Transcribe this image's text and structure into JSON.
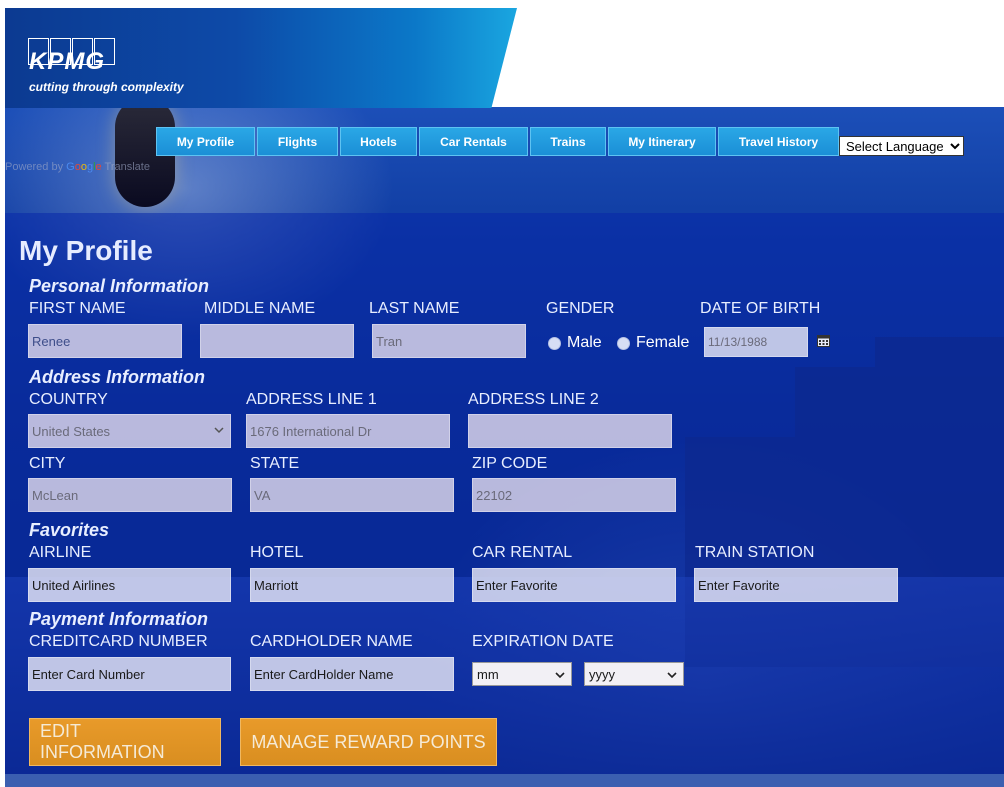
{
  "brand": {
    "logo_text": "KPMG",
    "tagline": "cutting through complexity"
  },
  "nav": {
    "items": [
      {
        "label": "My Profile"
      },
      {
        "label": "Flights"
      },
      {
        "label": "Hotels"
      },
      {
        "label": "Car Rentals"
      },
      {
        "label": "Trains"
      },
      {
        "label": "My Itinerary"
      },
      {
        "label": "Travel History"
      }
    ],
    "language_select": "Select Language"
  },
  "powered_by": {
    "prefix": "Powered by",
    "google": [
      "G",
      "o",
      "o",
      "g",
      "l",
      "e"
    ],
    "suffix": "Translate"
  },
  "page": {
    "title": "My Profile"
  },
  "personal": {
    "heading": "Personal Information",
    "first_name_label": "FIRST NAME",
    "first_name_value": "Renee",
    "middle_name_label": "MIDDLE NAME",
    "middle_name_value": "",
    "last_name_label": "LAST NAME",
    "last_name_value": "Tran",
    "gender_label": "GENDER",
    "gender_male": "Male",
    "gender_female": "Female",
    "dob_label": "DATE OF BIRTH",
    "dob_value": "11/13/1988"
  },
  "address": {
    "heading": "Address Information",
    "country_label": "COUNTRY",
    "country_value": "United States",
    "line1_label": "ADDRESS LINE 1",
    "line1_value": "1676 International Dr",
    "line2_label": "ADDRESS LINE 2",
    "line2_value": "",
    "city_label": "CITY",
    "city_value": "McLean",
    "state_label": "STATE",
    "state_value": "VA",
    "zip_label": "ZIP CODE",
    "zip_value": "22102"
  },
  "favorites": {
    "heading": "Favorites",
    "airline_label": "AIRLINE",
    "airline_value": "United Airlines",
    "hotel_label": "HOTEL",
    "hotel_value": "Marriott",
    "car_label": "CAR RENTAL",
    "car_placeholder": "Enter Favorite",
    "train_label": "TRAIN STATION",
    "train_placeholder": "Enter Favorite"
  },
  "payment": {
    "heading": "Payment Information",
    "card_label": "CREDITCARD NUMBER",
    "card_placeholder": "Enter Card Number",
    "holder_label": "CARDHOLDER NAME",
    "holder_placeholder": "Enter CardHolder Name",
    "exp_label": "EXPIRATION DATE",
    "exp_month": "mm",
    "exp_year": "yyyy"
  },
  "actions": {
    "edit_label": "EDIT INFORMATION",
    "rewards_label": "MANAGE REWARD POINTS"
  },
  "colors": {
    "nav_bg": "#1b8fd6",
    "button_bg": "#e0952a",
    "overlay": "#0828aa"
  }
}
